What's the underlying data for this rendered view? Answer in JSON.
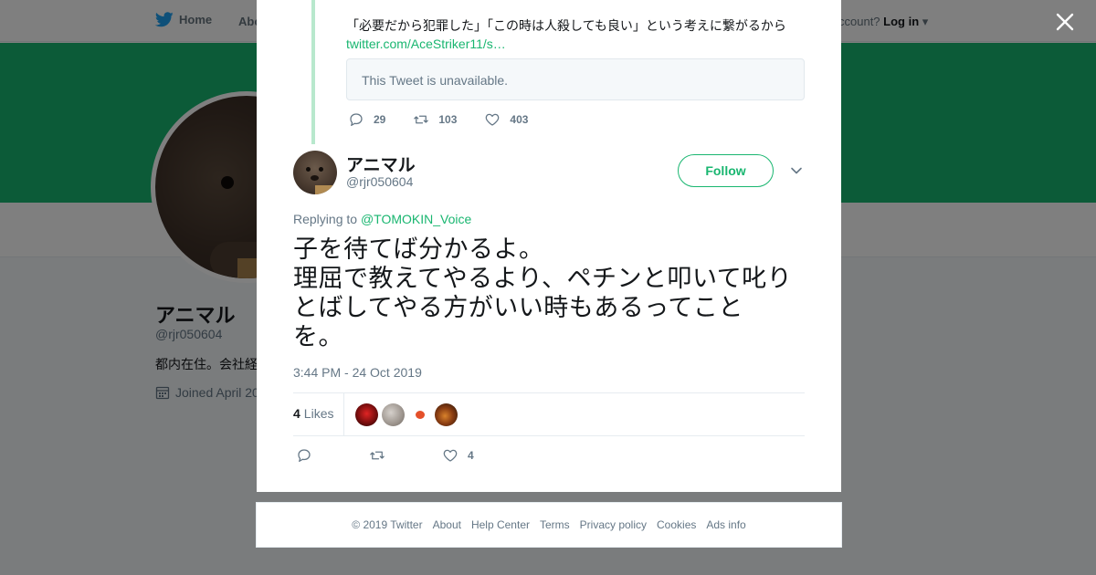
{
  "topbar": {
    "home_label": "Home",
    "about_label": "Abo",
    "account_prompt": "ccount?",
    "login_label": "Log in"
  },
  "background_profile": {
    "name": "アニマル",
    "handle": "@rjr050604",
    "bio": "都内在住。会社経",
    "joined": "Joined April 20"
  },
  "quoted_tweet": {
    "text": "「必要だから犯罪した」「この時は人殺しても良い」という考えに繋がるから",
    "link": "twitter.com/AceStriker11/s…",
    "unavailable_notice": "This Tweet is unavailable.",
    "replies": "29",
    "retweets": "103",
    "likes": "403"
  },
  "tweet": {
    "author_name": "アニマル",
    "author_handle": "@rjr050604",
    "follow_label": "Follow",
    "replying_prefix": "Replying to",
    "replying_to": "@TOMOKIN_Voice",
    "text_lines": [
      "子を待てば分かるよ。",
      "理屈で教えてやるより、ペチンと叩いて叱り",
      "とばしてやる方がいい時もあるってこと",
      "を。"
    ],
    "timestamp": "3:44 PM - 24 Oct 2019",
    "likes_count": "4",
    "likes_label": "Likes",
    "action_like_count": "4"
  },
  "footer": {
    "links": [
      "© 2019 Twitter",
      "About",
      "Help Center",
      "Terms",
      "Privacy policy",
      "Cookies",
      "Ads info"
    ]
  },
  "colors": {
    "accent": "#19b670",
    "banner": "#18b670",
    "text_primary": "#14171a",
    "text_secondary": "#657786"
  },
  "icons": [
    "twitter-bird-icon",
    "close-icon",
    "reply-icon",
    "retweet-icon",
    "like-icon",
    "chevron-down-icon",
    "calendar-icon"
  ]
}
